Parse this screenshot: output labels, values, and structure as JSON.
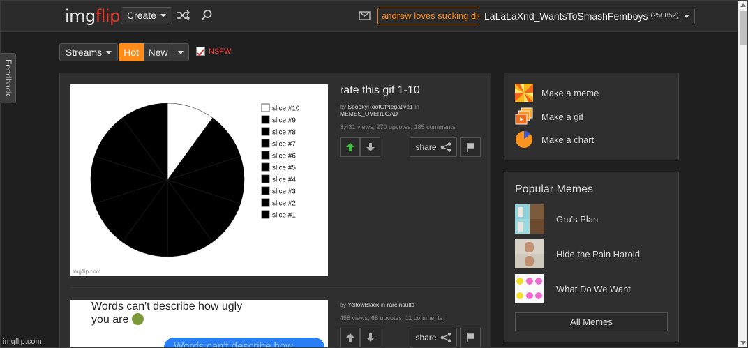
{
  "header": {
    "logo_a": "img",
    "logo_b": "flip",
    "create_label": "Create",
    "shuffle_icon": "shuffle-icon",
    "search_icon": "search-icon",
    "mail_icon": "mail-icon",
    "highlighted_name": "andrew loves sucking dick",
    "username": "LaLaLaXnd_WantsToSmashFemboys",
    "points": "(258852)"
  },
  "subnav": {
    "streams_label": "Streams",
    "hot_label": "Hot",
    "new_label": "New",
    "nsfw_label": "NSFW",
    "nsfw_checked": true
  },
  "feedback_label": "Feedback",
  "posts": [
    {
      "title": "rate this gif 1-10",
      "by_prefix": "by",
      "author": "SpookyRootOfNegative1",
      "in_word": "in",
      "stream": "MEMES_OVERLOAD",
      "stats": "3,431 views, 270 upvotes, 185 comments",
      "share_label": "share",
      "watermark": "imgflip.com"
    },
    {
      "title": "",
      "by_prefix": "by",
      "author": "YellowBlack",
      "in_word": "in",
      "stream": "rareinsults",
      "stats": "458 views, 68 upvotes, 11 comments",
      "share_label": "share",
      "image_text_1": "Words can't describe how ugly",
      "image_text_2": "you are",
      "image_text_3": "Words can't describe how"
    }
  ],
  "chart_data": {
    "type": "pie",
    "title": "",
    "categories": [
      "slice #10",
      "slice #9",
      "slice #8",
      "slice #7",
      "slice #6",
      "slice #5",
      "slice #4",
      "slice #3",
      "slice #2",
      "slice #1"
    ],
    "values": [
      10,
      10,
      10,
      10,
      10,
      10,
      10,
      10,
      10,
      10
    ],
    "colors": [
      "#ffffff",
      "#000000",
      "#000000",
      "#000000",
      "#000000",
      "#000000",
      "#000000",
      "#000000",
      "#000000",
      "#000000"
    ],
    "legend": "right"
  },
  "make_menu": [
    {
      "label": "Make a meme",
      "icon": "meme-pinwheel-icon"
    },
    {
      "label": "Make a gif",
      "icon": "gif-frames-icon"
    },
    {
      "label": "Make a chart",
      "icon": "pie-chart-icon"
    }
  ],
  "popular": {
    "title": "Popular Memes",
    "items": [
      {
        "label": "Gru's Plan"
      },
      {
        "label": "Hide the Pain Harold"
      },
      {
        "label": "What Do We Want"
      }
    ],
    "all_label": "All Memes"
  },
  "footer_watermark": "imgflip.com"
}
